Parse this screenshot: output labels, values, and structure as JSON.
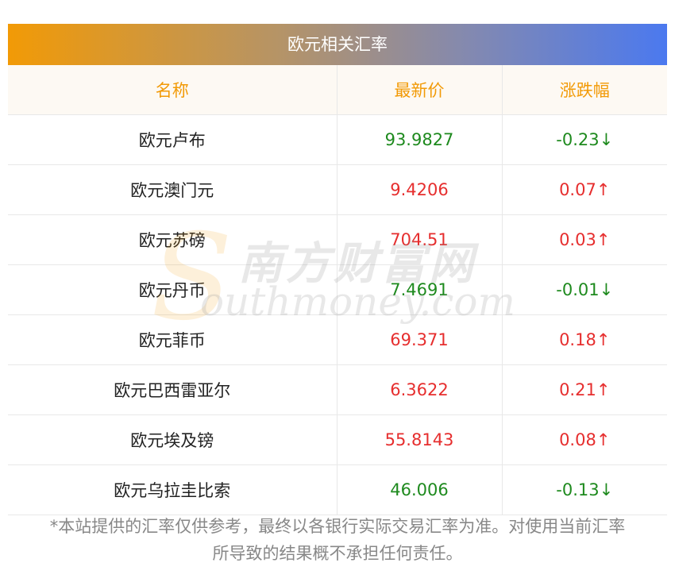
{
  "title": "欧元相关汇率",
  "headers": [
    "名称",
    "最新价",
    "涨跌幅"
  ],
  "rows": [
    {
      "name": "欧元卢布",
      "price": "93.9827",
      "change": "-0.23↓",
      "dir": "down"
    },
    {
      "name": "欧元澳门元",
      "price": "9.4206",
      "change": "0.07↑",
      "dir": "up"
    },
    {
      "name": "欧元苏磅",
      "price": "704.51",
      "change": "0.03↑",
      "dir": "up"
    },
    {
      "name": "欧元丹币",
      "price": "7.4691",
      "change": "-0.01↓",
      "dir": "down"
    },
    {
      "name": "欧元菲币",
      "price": "69.371",
      "change": "0.18↑",
      "dir": "up"
    },
    {
      "name": "欧元巴西雷亚尔",
      "price": "6.3622",
      "change": "0.21↑",
      "dir": "up"
    },
    {
      "name": "欧元埃及镑",
      "price": "55.8143",
      "change": "0.08↑",
      "dir": "up"
    },
    {
      "name": "欧元乌拉圭比索",
      "price": "46.006",
      "change": "-0.13↓",
      "dir": "down"
    }
  ],
  "note_line1": "*本站提供的汇率仅供参考，最终以各银行实际交易汇率为准。对使用当前汇率",
  "note_line2": "所导致的结果概不承担任何责任。",
  "watermark": {
    "cn": "南方财富网",
    "en": "outhmoney.com",
    "initial": "S"
  },
  "colors": {
    "header_text": "#f29a06",
    "up": "#e62e2e",
    "down": "#1e8a1e",
    "gradient_start": "#f29a06",
    "gradient_end": "#4b79ef"
  }
}
